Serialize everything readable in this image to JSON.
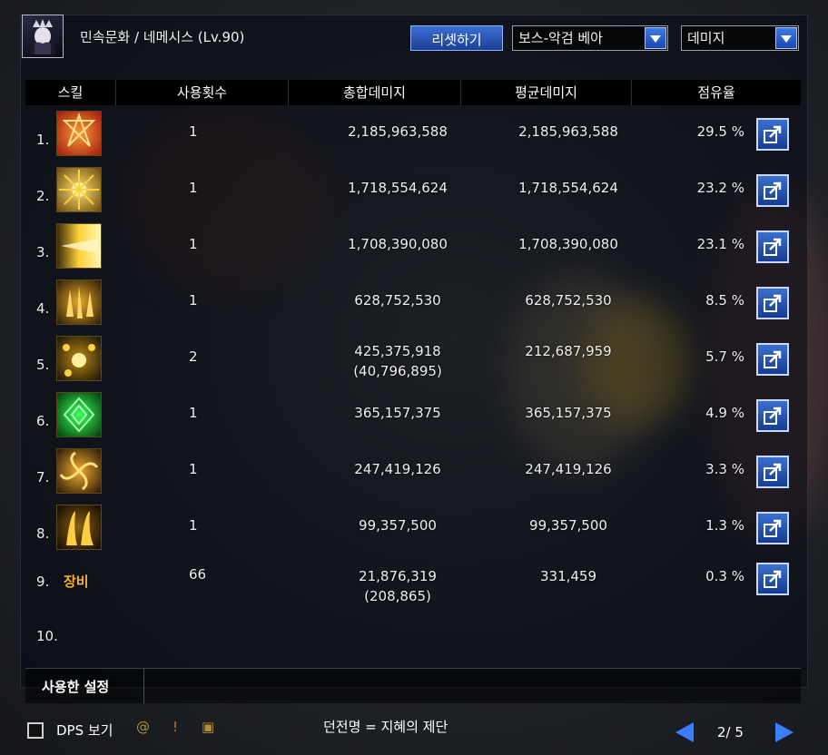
{
  "header": {
    "character": "민속문화 / 네메시스 (Lv.90)",
    "reset_label": "리셋하기",
    "target_dropdown": "보스-악검 베아",
    "metric_dropdown": "데미지"
  },
  "table": {
    "columns": [
      "스킬",
      "사용횟수",
      "총합데미지",
      "평균데미지",
      "점유율"
    ],
    "rows": [
      {
        "index": "1.",
        "icon": "red-star-sigil-icon",
        "uses": "1",
        "total": "2,185,963,588",
        "total_sub": "",
        "avg": "2,185,963,588",
        "share": "29.5 %"
      },
      {
        "index": "2.",
        "icon": "golden-sunburst-icon",
        "uses": "1",
        "total": "1,718,554,624",
        "total_sub": "",
        "avg": "1,718,554,624",
        "share": "23.2 %"
      },
      {
        "index": "3.",
        "icon": "light-beam-icon",
        "uses": "1",
        "total": "1,708,390,080",
        "total_sub": "",
        "avg": "1,708,390,080",
        "share": "23.1 %"
      },
      {
        "index": "4.",
        "icon": "flame-crystals-icon",
        "uses": "1",
        "total": "628,752,530",
        "total_sub": "",
        "avg": "628,752,530",
        "share": "8.5 %"
      },
      {
        "index": "5.",
        "icon": "orbs-burst-icon",
        "uses": "2",
        "total": "425,375,918",
        "total_sub": "(40,796,895)",
        "avg": "212,687,959",
        "share": "5.7 %"
      },
      {
        "index": "6.",
        "icon": "green-rune-icon",
        "uses": "1",
        "total": "365,157,375",
        "total_sub": "",
        "avg": "365,157,375",
        "share": "4.9 %"
      },
      {
        "index": "7.",
        "icon": "golden-vortex-icon",
        "uses": "1",
        "total": "247,419,126",
        "total_sub": "",
        "avg": "247,419,126",
        "share": "3.3 %"
      },
      {
        "index": "8.",
        "icon": "golden-claws-icon",
        "uses": "1",
        "total": "99,357,500",
        "total_sub": "",
        "avg": "99,357,500",
        "share": "1.3 %"
      },
      {
        "index": "9.",
        "icon_text": "장비",
        "uses": "66",
        "total": "21,876,319",
        "total_sub": "(208,865)",
        "avg": "331,459",
        "share": "0.3 %"
      },
      {
        "index": "10.",
        "icon": "",
        "uses": "",
        "total": "",
        "total_sub": "",
        "avg": "",
        "share": ""
      }
    ]
  },
  "footer": {
    "settings_label": "사용한 설정"
  },
  "bottom": {
    "dps_label": "DPS 보기",
    "dungeon": "던전명 = 지혜의 제단",
    "page": "2/ 5"
  }
}
